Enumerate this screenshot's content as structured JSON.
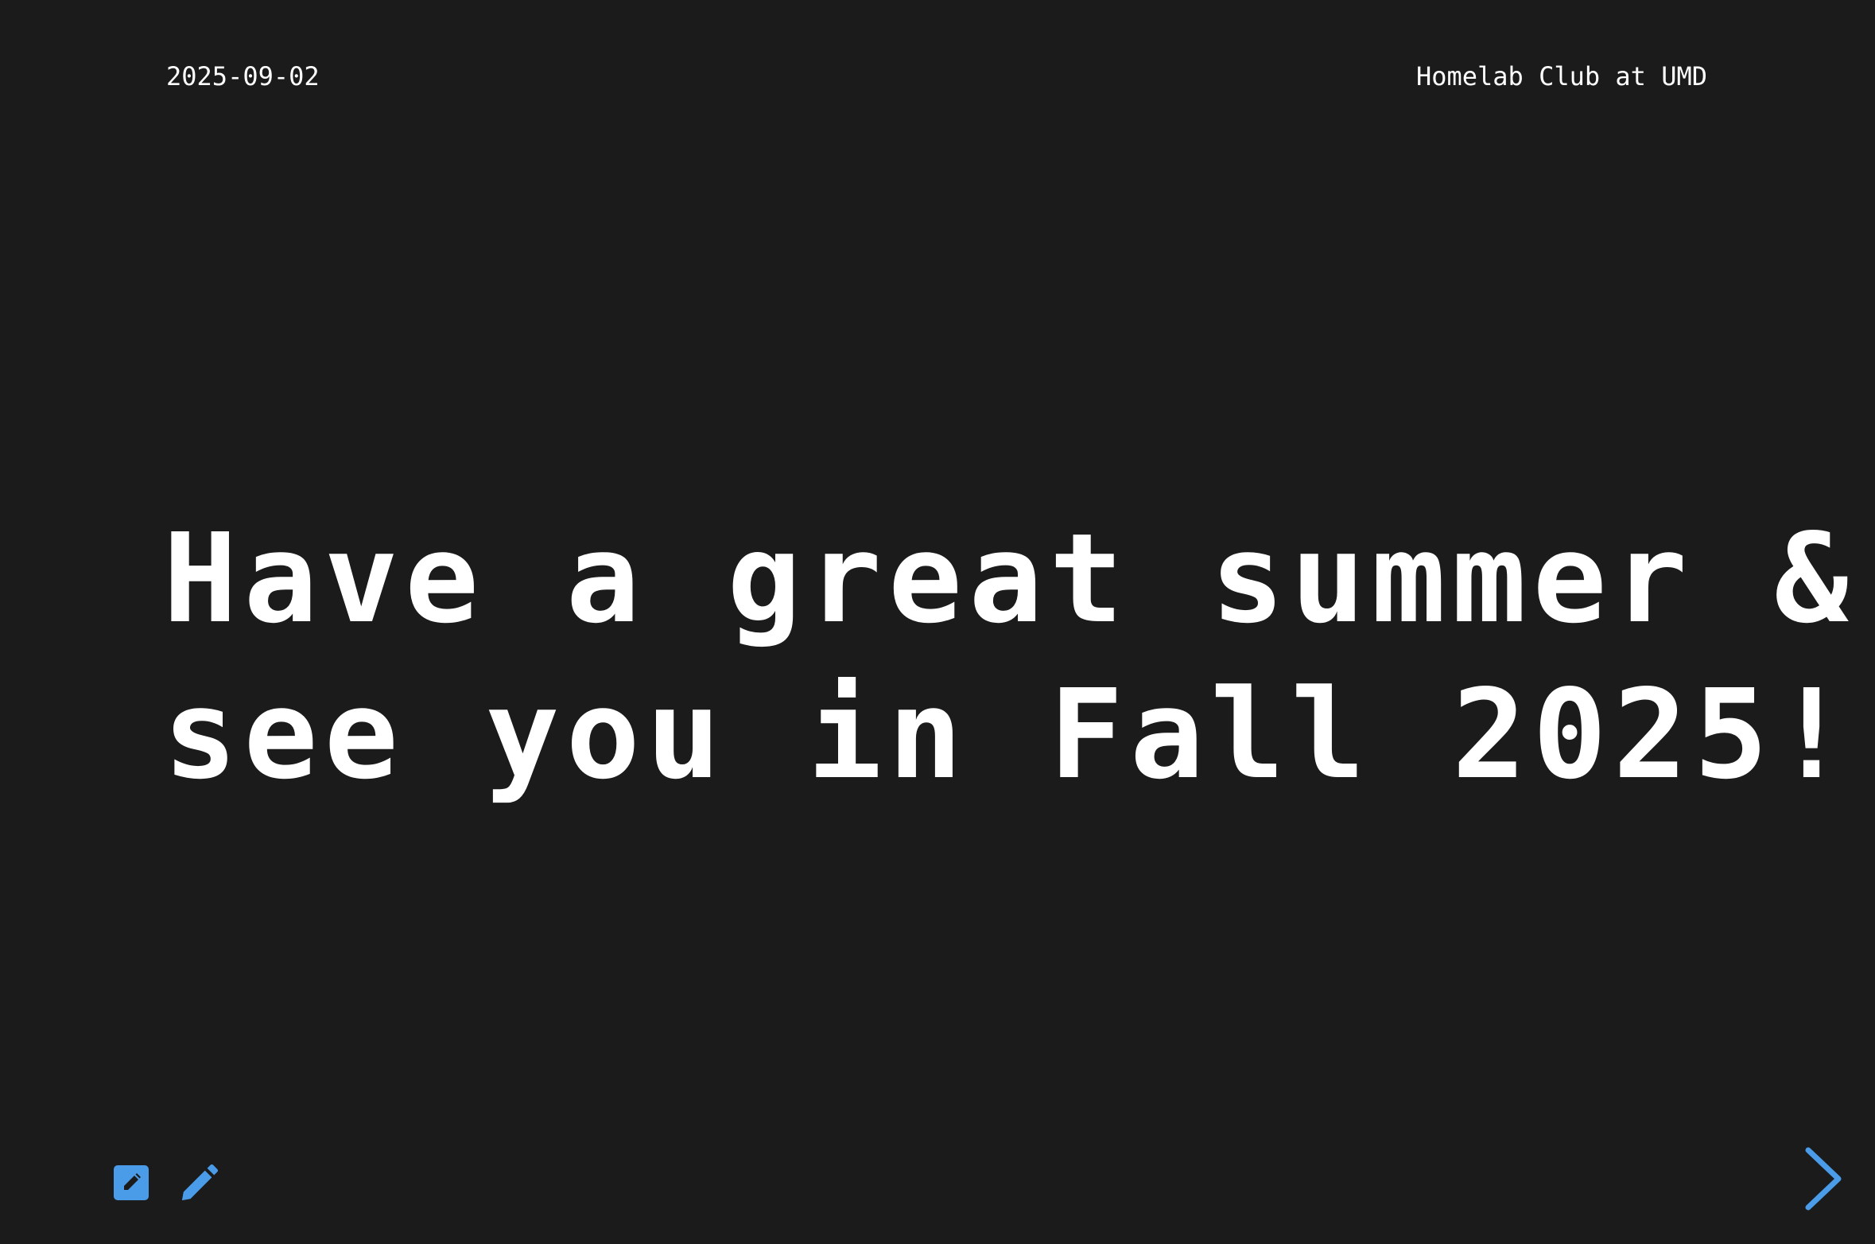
{
  "header": {
    "date": "2025-09-02",
    "organization": "Homelab Club at UMD"
  },
  "slide": {
    "headline_lines": [
      "Have a great summer &",
      "see you in Fall 2025!"
    ]
  },
  "toolbar": {
    "icons": [
      "edit-square-icon",
      "pencil-icon"
    ]
  },
  "navigation": {
    "next_icon": "chevron-right-icon"
  },
  "colors": {
    "background": "#1b1b1b",
    "text": "#ffffff",
    "accent": "#4a9be8"
  }
}
